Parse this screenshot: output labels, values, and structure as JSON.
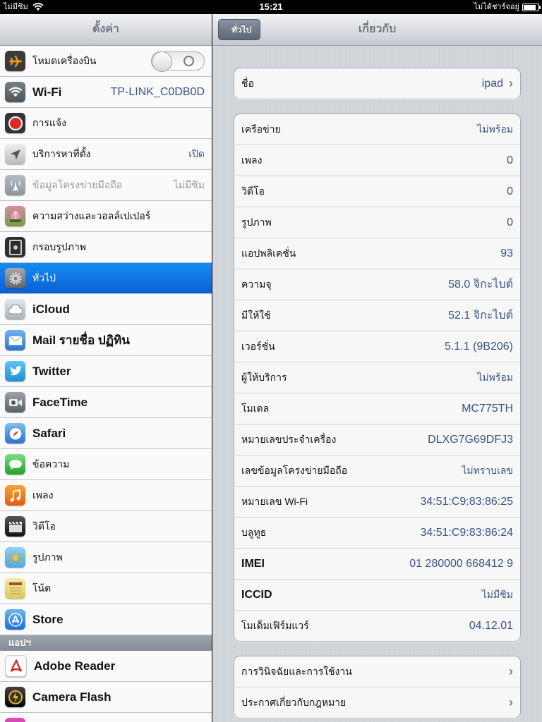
{
  "status": {
    "carrier": "ไม่มีซิม",
    "time": "15:21",
    "charge_text": "ไม่ได้ชาร์จอยู่"
  },
  "left": {
    "title": "ตั้งค่า",
    "items": [
      {
        "label": "โหมดเครื่องบิน",
        "icon": "airplane-icon",
        "color": "#f29a1e"
      },
      {
        "label": "Wi-Fi",
        "value": "TP-LINK_C0DB0D",
        "icon": "wifi-icon",
        "color": "#4a77c8"
      },
      {
        "label": "การแจ้ง",
        "icon": "notifications-icon",
        "color": "#e12828"
      },
      {
        "label": "บริการหาที่ตั้ง",
        "value": "เปิด",
        "icon": "location-icon",
        "color": "#7a7f86"
      },
      {
        "label": "ข้อมูลโครงข่ายมือถือ",
        "value": "ไม่มีซิม",
        "icon": "cellular-icon",
        "color": "#9aa0a6"
      },
      {
        "label": "ความสว่างและวอลล์เปเปอร์",
        "icon": "brightness-icon",
        "color": "#7b9a48"
      },
      {
        "label": "กรอบรูปภาพ",
        "icon": "picture-frame-icon",
        "color": "#555"
      },
      {
        "label": "ทั่วไป",
        "icon": "gear-icon",
        "color": "#7a7f86"
      },
      {
        "label": "iCloud",
        "icon": "cloud-icon",
        "color": "#9aa3ac"
      },
      {
        "label": "Mail รายชื่อ ปฏิทิน",
        "icon": "mail-icon",
        "color": "#3d89df"
      },
      {
        "label": "Twitter",
        "icon": "twitter-icon",
        "color": "#2fa7e6"
      },
      {
        "label": "FaceTime",
        "icon": "facetime-icon",
        "color": "#6b7077"
      },
      {
        "label": "Safari",
        "icon": "safari-icon",
        "color": "#3d8de0"
      },
      {
        "label": "ข้อความ",
        "icon": "messages-icon",
        "color": "#2fbf3c"
      },
      {
        "label": "เพลง",
        "icon": "music-icon",
        "color": "#f06c16"
      },
      {
        "label": "วิดีโอ",
        "icon": "video-icon",
        "color": "#333"
      },
      {
        "label": "รูปภาพ",
        "icon": "photos-icon",
        "color": "#f3c323"
      },
      {
        "label": "โน้ต",
        "icon": "notes-icon",
        "color": "#e6d26a"
      },
      {
        "label": "Store",
        "icon": "store-icon",
        "color": "#2f7ee0"
      }
    ],
    "apps_header": "แอปฯ",
    "apps": [
      {
        "label": "Adobe Reader",
        "icon": "adobe-reader-icon",
        "color": "#d51b1b"
      },
      {
        "label": "Camera Flash",
        "icon": "camera-flash-icon",
        "color": "#222"
      }
    ]
  },
  "right": {
    "back_label": "ทั่วไป",
    "title": "เกี่ยวกับ",
    "name_row": {
      "key": "ชื่อ",
      "value": "ipad"
    },
    "info": [
      {
        "key": "เครือข่าย",
        "value": "ไม่พร้อม"
      },
      {
        "key": "เพลง",
        "value": "0"
      },
      {
        "key": "วิดีโอ",
        "value": "0"
      },
      {
        "key": "รูปภาพ",
        "value": "0"
      },
      {
        "key": "แอปพลิเคชั่น",
        "value": "93"
      },
      {
        "key": "ความจุ",
        "value": "58.0 จิกะไบต์"
      },
      {
        "key": "มีให้ใช้",
        "value": "52.1 จิกะไบต์"
      },
      {
        "key": "เวอร์ชั่น",
        "value": "5.1.1 (9B206)"
      },
      {
        "key": "ผู้ให้บริการ",
        "value": "ไม่พร้อม"
      },
      {
        "key": "โมเดล",
        "value": "MC775TH"
      },
      {
        "key": "หมายเลขประจำเครื่อง",
        "value": "DLXG7G69DFJ3"
      },
      {
        "key": "เลขข้อมูลโครงข่ายมือถือ",
        "value": "ไม่ทราบเลข"
      },
      {
        "key": "หมายเลข Wi-Fi",
        "value": "34:51:C9:83:86:25"
      },
      {
        "key": "บลูทูธ",
        "value": "34:51:C9:83:86:24"
      },
      {
        "key": "IMEI",
        "value": "01 280000 668412 9"
      },
      {
        "key": "ICCID",
        "value": "ไม่มีซิม"
      },
      {
        "key": "โมเด็มเฟิร์มแวร์",
        "value": "04.12.01"
      }
    ],
    "links": [
      {
        "key": "การวินิจฉัยและการใช้งาน"
      },
      {
        "key": "ประกาศเกี่ยวกับกฎหมาย"
      }
    ]
  }
}
